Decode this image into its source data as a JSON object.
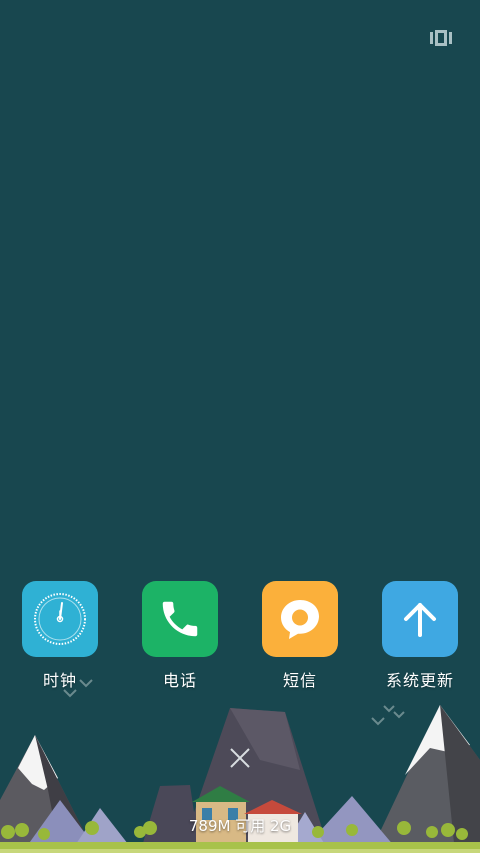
{
  "screen": {
    "background": "#18474f"
  },
  "toolbar": {
    "recents_icon": "recents-icon"
  },
  "apps": [
    {
      "label": "时钟",
      "icon": "clock-icon",
      "color": "#2fb1d4"
    },
    {
      "label": "电话",
      "icon": "phone-icon",
      "color": "#1cb366"
    },
    {
      "label": "短信",
      "icon": "message-icon",
      "color": "#fbb03b"
    },
    {
      "label": "系统更新",
      "icon": "arrow-up-icon",
      "color": "#3fa8e2"
    }
  ],
  "bottom": {
    "close_icon": "close-icon",
    "memory_text": "789M 可用 2G"
  }
}
